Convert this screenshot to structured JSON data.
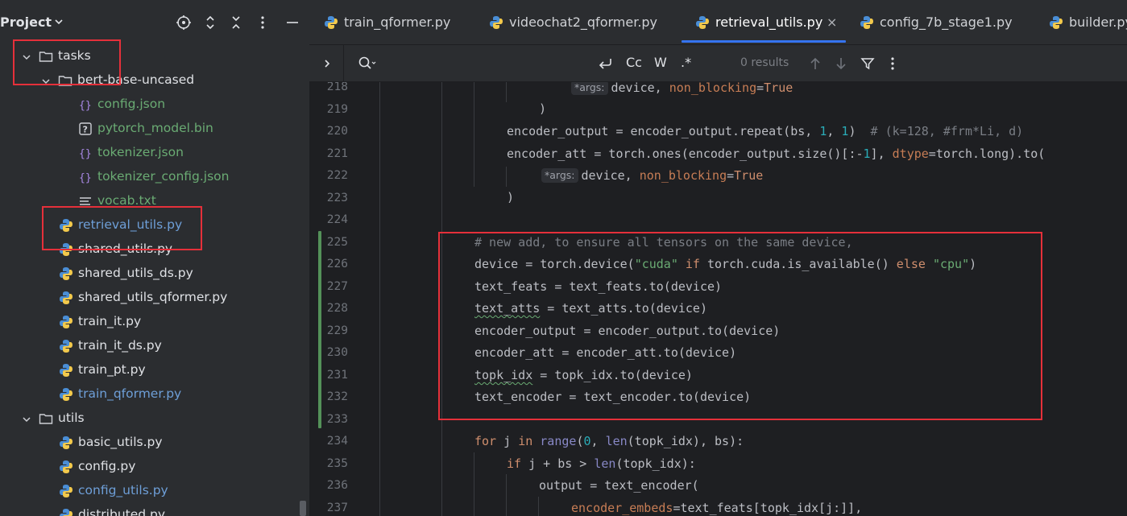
{
  "project_panel": {
    "title": "Project",
    "tree": [
      {
        "label": "tasks",
        "kind": "folder",
        "expanded": true
      },
      {
        "label": "bert-base-uncased",
        "kind": "folder",
        "expanded": true
      },
      {
        "label": "config.json",
        "kind": "json"
      },
      {
        "label": "pytorch_model.bin",
        "kind": "unknown"
      },
      {
        "label": "tokenizer.json",
        "kind": "json"
      },
      {
        "label": "tokenizer_config.json",
        "kind": "json"
      },
      {
        "label": "vocab.txt",
        "kind": "text"
      },
      {
        "label": "retrieval_utils.py",
        "kind": "python"
      },
      {
        "label": "shared_utils.py",
        "kind": "python"
      },
      {
        "label": "shared_utils_ds.py",
        "kind": "python"
      },
      {
        "label": "shared_utils_qformer.py",
        "kind": "python"
      },
      {
        "label": "train_it.py",
        "kind": "python"
      },
      {
        "label": "train_it_ds.py",
        "kind": "python"
      },
      {
        "label": "train_pt.py",
        "kind": "python"
      },
      {
        "label": "train_qformer.py",
        "kind": "python"
      },
      {
        "label": "utils",
        "kind": "folder",
        "expanded": true
      },
      {
        "label": "basic_utils.py",
        "kind": "python"
      },
      {
        "label": "config.py",
        "kind": "python"
      },
      {
        "label": "config_utils.py",
        "kind": "python"
      },
      {
        "label": "distributed.py",
        "kind": "python"
      }
    ]
  },
  "tabs": [
    {
      "label": "train_qformer.py",
      "active": false
    },
    {
      "label": "videochat2_qformer.py",
      "active": false
    },
    {
      "label": "retrieval_utils.py",
      "active": true
    },
    {
      "label": "config_7b_stage1.py",
      "active": false
    },
    {
      "label": "builder.py",
      "active": false
    }
  ],
  "tab_close_glyph": "×",
  "find_bar": {
    "query": "",
    "match_case_label": "Cc",
    "whole_word_label": "W",
    "regex_label": ".*",
    "results": "0 results"
  },
  "editor": {
    "line_numbers": [
      "218",
      "219",
      "220",
      "221",
      "222",
      "223",
      "224",
      "225",
      "226",
      "227",
      "228",
      "229",
      "230",
      "231",
      "232",
      "233",
      "234",
      "235",
      "236",
      "237"
    ],
    "hint_args": "*args:",
    "lines": {
      "l218": {
        "rest": "device, ",
        "param": "non_blocking",
        "eq": "=",
        "kw": "True"
      },
      "l219": ")",
      "l220": {
        "a": "encoder_output = encoder_output.repeat(bs, ",
        "n1": "1",
        "c1": ", ",
        "n2": "1",
        "c2": ")  ",
        "cmt": "# (k=128, #frm*Li, d)"
      },
      "l221": {
        "a": "encoder_att = torch.ones(encoder_output.size()[:-",
        "n1": "1",
        "b": "], ",
        "param": "dtype",
        "c": "=torch.long).to("
      },
      "l222": {
        "rest": "device, ",
        "param": "non_blocking",
        "eq": "=",
        "kw": "True"
      },
      "l223": ")",
      "l225": "# new add, to ensure all tensors on the same device,",
      "l226": {
        "a": "device = torch.device(",
        "s1": "\"cuda\"",
        "k1": " if ",
        "b": "torch.cuda.is_available()",
        "k2": " else ",
        "s2": "\"cpu\"",
        "c": ")"
      },
      "l227": "text_feats = text_feats.to(device)",
      "l228": {
        "sq": "text_atts",
        "rest": " = text_atts.to(device)"
      },
      "l229": "encoder_output = encoder_output.to(device)",
      "l230": "encoder_att = encoder_att.to(device)",
      "l231": {
        "sq": "topk_idx",
        "rest": " = topk_idx.to(device)"
      },
      "l232": "text_encoder = text_encoder.to(device)",
      "l234": {
        "k1": "for",
        "a": " j ",
        "k2": "in",
        "b": " ",
        "f1": "range",
        "c": "(",
        "n1": "0",
        "d": ", ",
        "f2": "len",
        "e": "(topk_idx), bs):"
      },
      "l235": {
        "k1": "if",
        "a": " j + bs > ",
        "f1": "len",
        "b": "(topk_idx):"
      },
      "l236": "output = text_encoder(",
      "l237": {
        "param": "encoder_embeds",
        "rest": "=text_feats[topk_idx[j:]],"
      }
    }
  },
  "colors": {
    "annotation": "#e5303a",
    "accent": "#3574f0",
    "change_marker": "#549159"
  }
}
